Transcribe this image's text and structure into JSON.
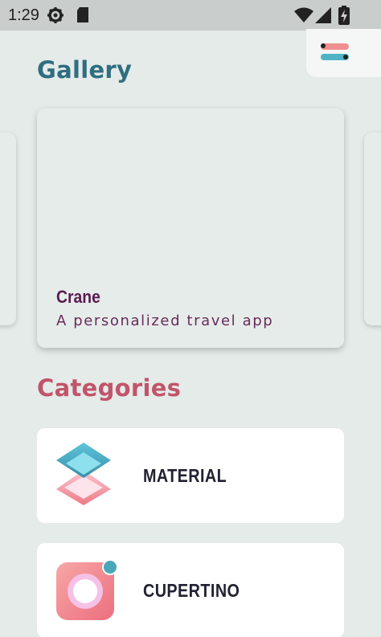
{
  "status_bar": {
    "time": "1:29",
    "icons": [
      "gear-icon",
      "sd-card-icon",
      "wifi-icon",
      "signal-icon",
      "battery-icon"
    ]
  },
  "toolbar": {
    "settings_icon": "settings-toggle-icon"
  },
  "gallery": {
    "title": "Gallery",
    "studies": [
      {
        "title": "Crane",
        "subtitle": "A personalized travel app"
      }
    ]
  },
  "categories": {
    "title": "Categories",
    "items": [
      {
        "label": "MATERIAL",
        "icon": "material-layers-icon"
      },
      {
        "label": "CUPERTINO",
        "icon": "cupertino-icon"
      }
    ]
  },
  "colors": {
    "background": "#e4ebe9",
    "gallery_title": "#2f6e80",
    "categories_title": "#c2546a",
    "study_title": "#5a1c4f",
    "category_label": "#222233"
  }
}
